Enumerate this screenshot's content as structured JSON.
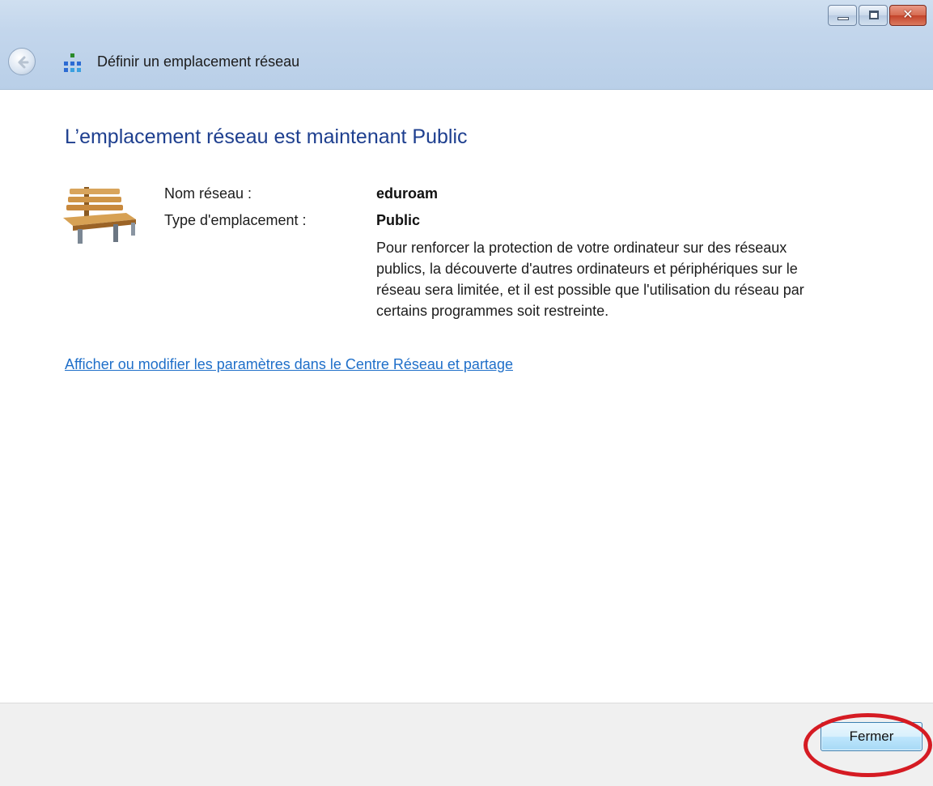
{
  "window": {
    "title": "Définir un emplacement réseau",
    "caption_buttons": [
      "minimize",
      "maximize",
      "close"
    ]
  },
  "main": {
    "heading": "L’emplacement réseau est maintenant Public",
    "network_name_label": "Nom réseau :",
    "network_name_value": "eduroam",
    "location_type_label": "Type d'emplacement :",
    "location_type_value": "Public",
    "description": "Pour renforcer la protection de votre ordinateur sur des réseaux publics, la découverte d'autres ordinateurs et périphériques sur le réseau sera limitée, et il est possible que l'utilisation du réseau par certains programmes soit restreinte.",
    "settings_link": "Afficher ou modifier les paramètres dans le Centre Réseau et partage"
  },
  "footer": {
    "close_button_label": "Fermer"
  },
  "icons": {
    "back": "back-arrow-icon",
    "network": "network-icon",
    "location": "park-bench-icon"
  },
  "colors": {
    "heading": "#1e3f8f",
    "link": "#1f6fc9",
    "annotation": "#d51b23"
  }
}
